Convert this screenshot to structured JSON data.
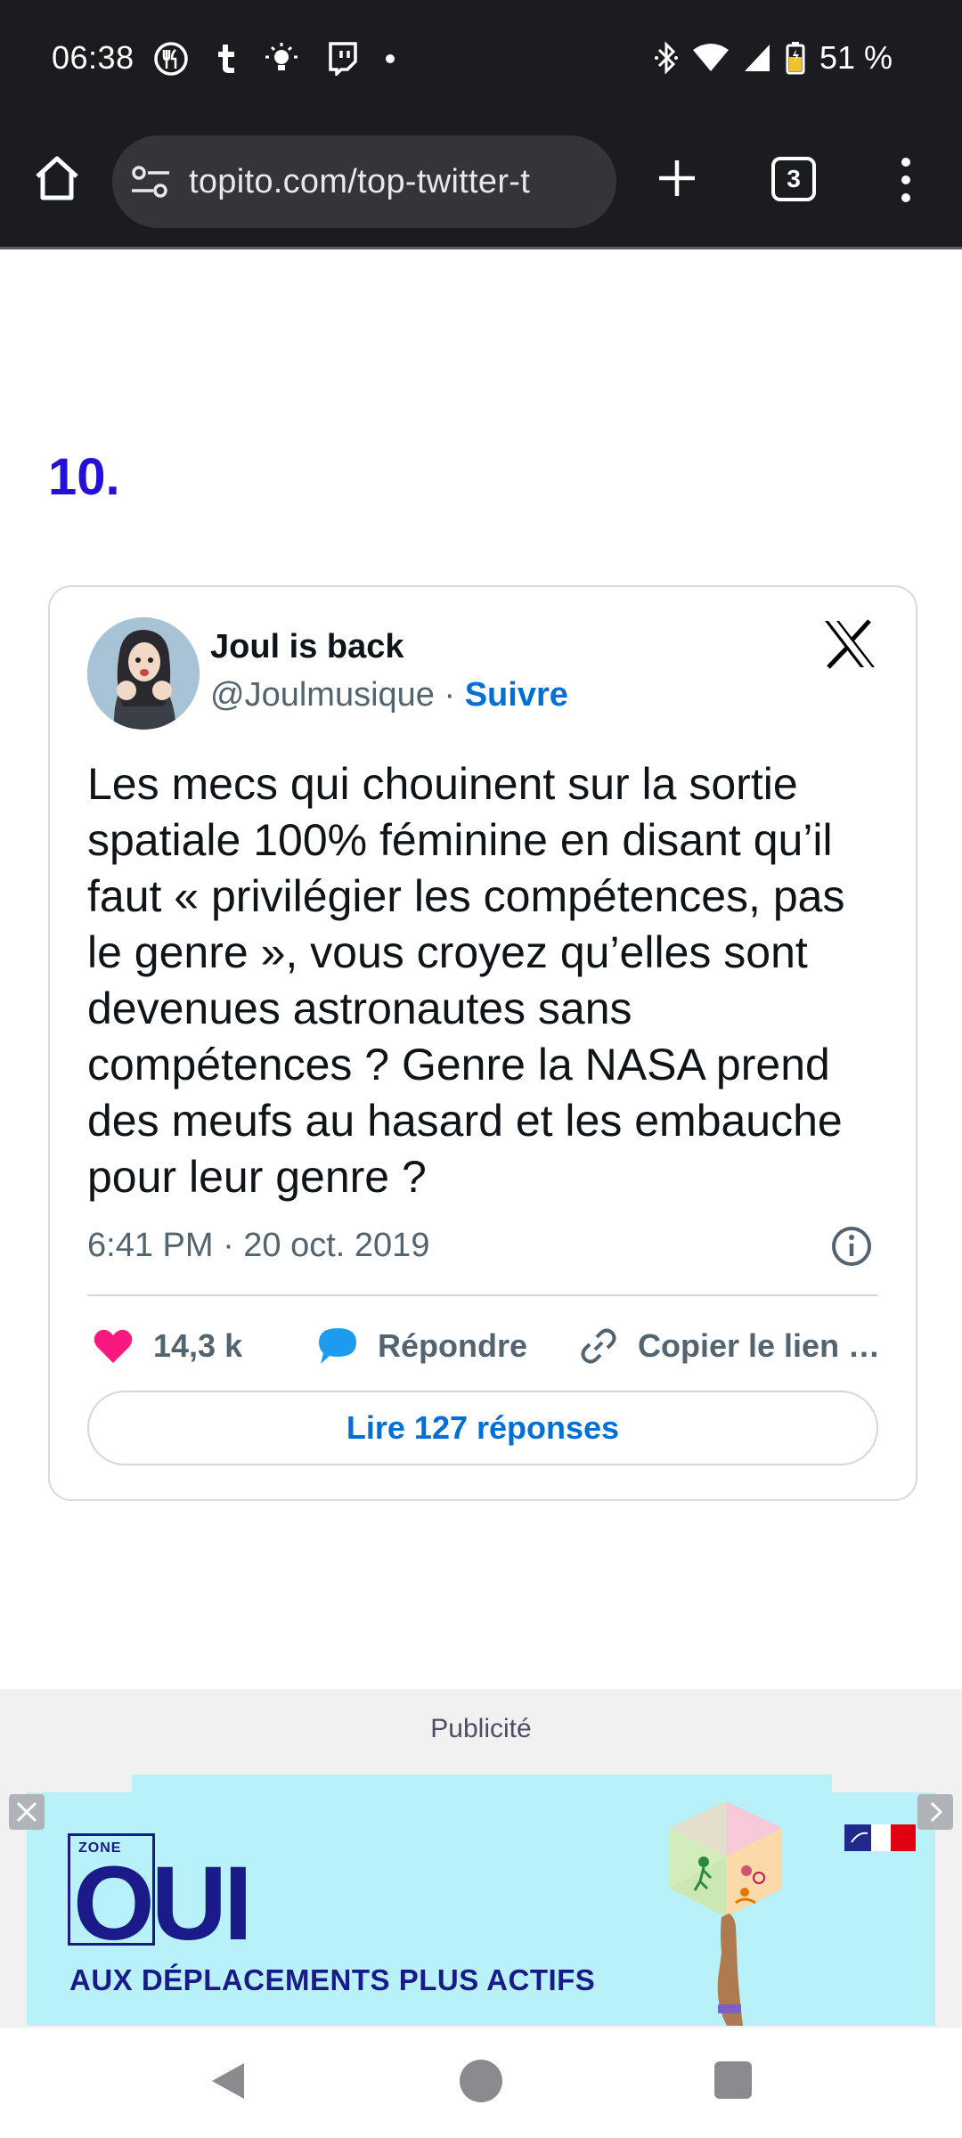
{
  "status_bar": {
    "time": "06:38",
    "battery": "51 %",
    "notification_icons": [
      "fork-knife-icon",
      "tumblr-icon",
      "lightbulb-icon",
      "twitch-icon",
      "dot-icon"
    ],
    "system_icons": [
      "bluetooth-icon",
      "wifi-icon",
      "signal-icon",
      "battery-icon"
    ]
  },
  "browser": {
    "url": "topito.com/top-twitter-t",
    "tab_count": "3"
  },
  "article": {
    "rank": "10."
  },
  "tweet": {
    "name": "Joul is back",
    "handle": "@Joulmusique",
    "separator": " · ",
    "follow": "Suivre",
    "text": "Les mecs qui chouinent sur la sortie spatiale 100% féminine en disant qu’il faut « privilégier les compétences, pas le genre », vous croyez qu’elles sont devenues astronautes sans compétences ? Genre la NASA prend des meufs au hasard et les embauche pour leur genre ?",
    "date": "6:41 PM · 20 oct. 2019",
    "likes": "14,3 k",
    "reply": "Répondre",
    "copy_link": "Copier le lien …",
    "read_replies": "Lire 127 réponses"
  },
  "ad": {
    "label": "Publicité",
    "zone": "ZONE",
    "headline": "OUI",
    "tagline": "AUX DÉPLACEMENTS PLUS ACTIFS"
  },
  "colors": {
    "rank": "#2410d6",
    "link_blue": "#006fd6",
    "like_pink": "#f91880",
    "ad_background": "#b8f2f8",
    "ad_navy": "#1b1a8a"
  }
}
